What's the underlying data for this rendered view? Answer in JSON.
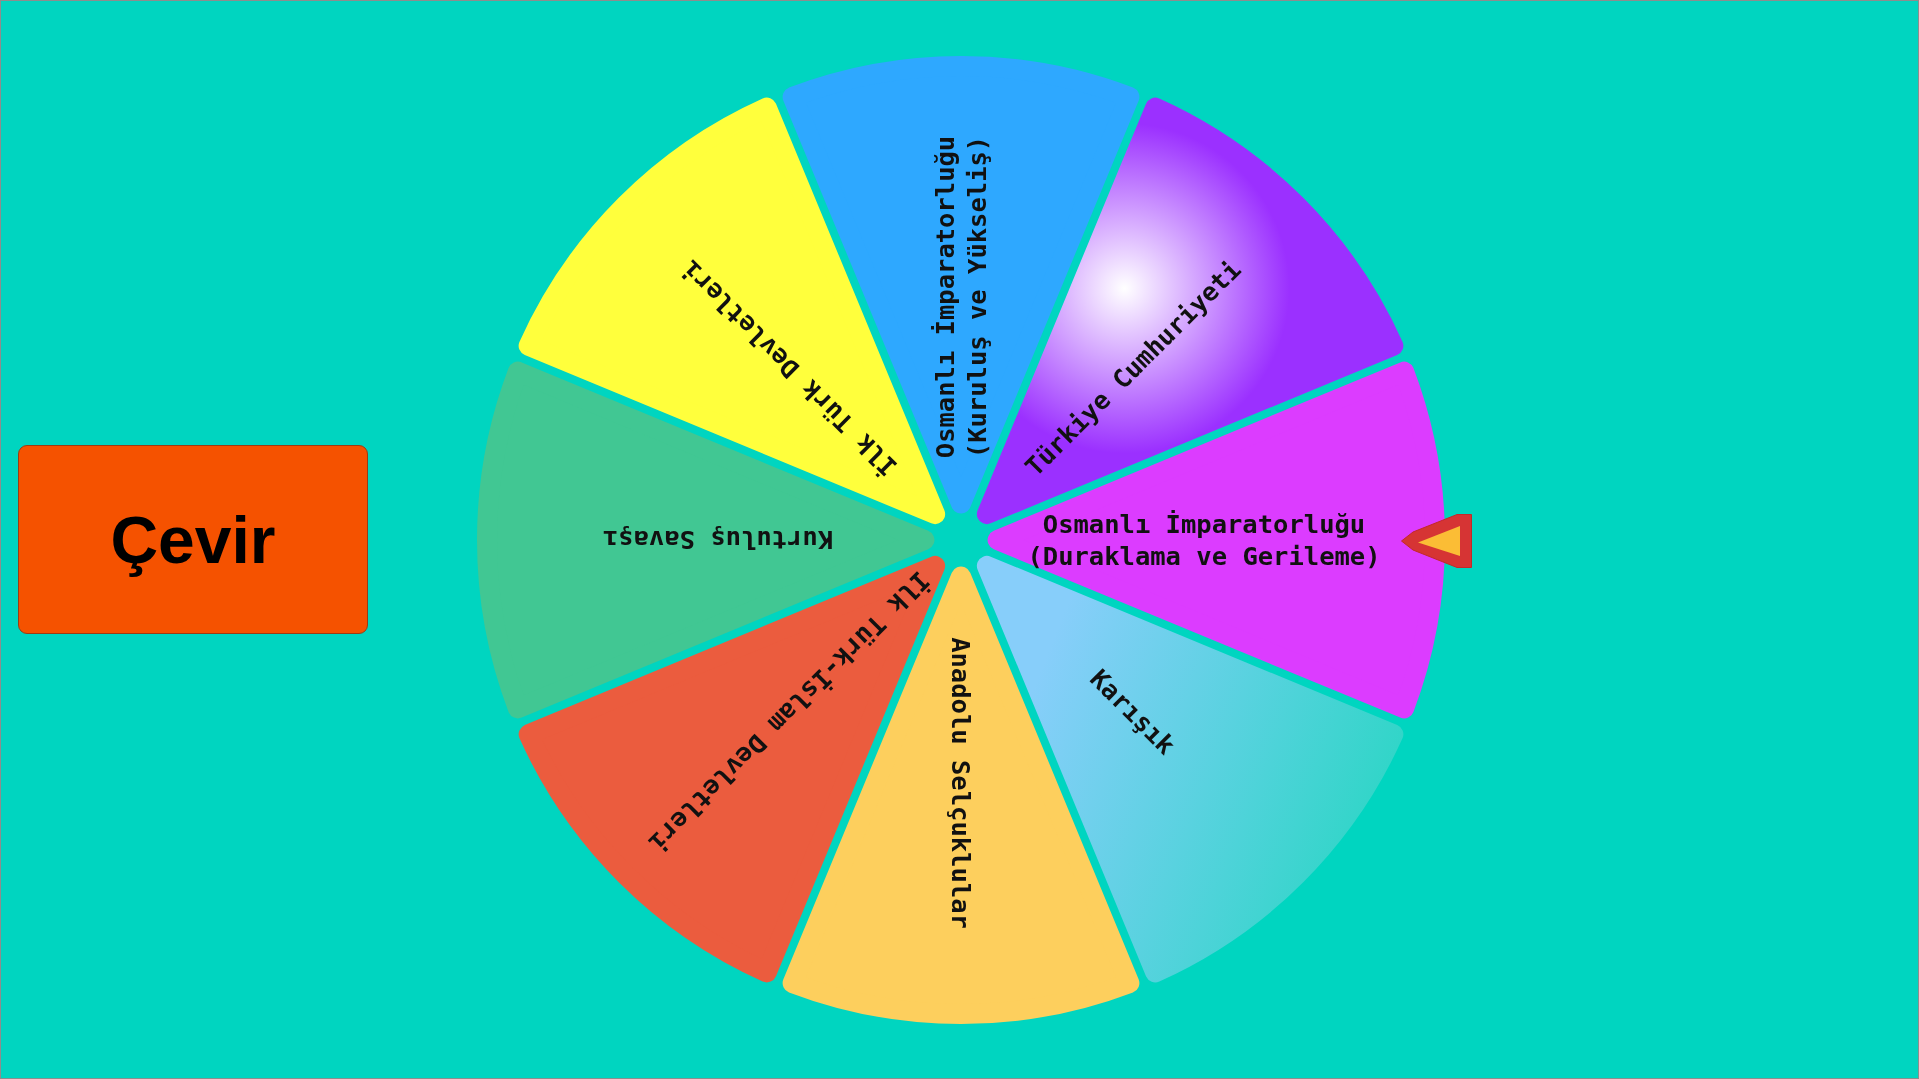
{
  "spin_button": {
    "label": "Çevir"
  },
  "wheel": {
    "segments": [
      {
        "lines": [
          "Osmanlı İmparatorluğu",
          "(Kuruluş ve Yükseliş)"
        ],
        "kind": "solid",
        "color": "#2ea8ff"
      },
      {
        "lines": [
          "Türkiye Cumhuriyeti"
        ],
        "kind": "radial",
        "color": "#9b30ff"
      },
      {
        "lines": [
          "Osmanlı İmparatorluğu",
          "(Duraklama ve Gerileme)"
        ],
        "kind": "solid",
        "color": "#dc3cff"
      },
      {
        "lines": [
          "Karışık"
        ],
        "kind": "linear",
        "color": "#87cefa"
      },
      {
        "lines": [
          "Anadolu Selçuklular"
        ],
        "kind": "solid",
        "color": "#fdcf5d"
      },
      {
        "lines": [
          "İlk Türk-İslam Devletleri"
        ],
        "kind": "solid",
        "color": "#eb5c3e"
      },
      {
        "lines": [
          "Kurtuluş Savaşı"
        ],
        "kind": "solid",
        "color": "#41c793"
      },
      {
        "lines": [
          "İlk Türk Devletleri"
        ],
        "kind": "solid",
        "color": "#ffff3c"
      }
    ]
  }
}
